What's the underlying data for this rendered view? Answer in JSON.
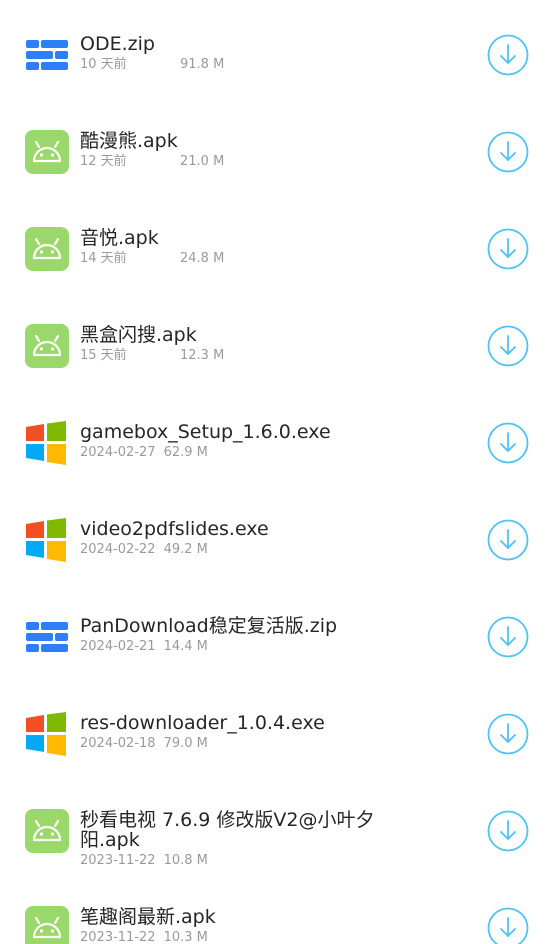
{
  "colors": {
    "accent": "#4fc3f7",
    "android_green": "#9bd86b",
    "zip_blue": "#2d7ff5",
    "win_red": "#f25022",
    "win_green": "#7fba00",
    "win_blue": "#03a9f4",
    "win_yellow": "#ffb900"
  },
  "files": [
    {
      "name": "ODE.zip",
      "date": "10 天前",
      "size": "91.8 M",
      "icon": "zip-file-icon"
    },
    {
      "name": "酷漫熊.apk",
      "date": "12 天前",
      "size": "21.0 M",
      "icon": "android-icon"
    },
    {
      "name": "音悦.apk",
      "date": "14 天前",
      "size": "24.8 M",
      "icon": "android-icon"
    },
    {
      "name": "黑盒闪搜.apk",
      "date": "15 天前",
      "size": "12.3 M",
      "icon": "android-icon"
    },
    {
      "name": "gamebox_Setup_1.6.0.exe",
      "date": "2024-02-27",
      "size": "62.9 M",
      "icon": "windows-icon"
    },
    {
      "name": "video2pdfslides.exe",
      "date": "2024-02-22",
      "size": "49.2 M",
      "icon": "windows-icon"
    },
    {
      "name": "PanDownload稳定复活版.zip",
      "date": "2024-02-21",
      "size": "14.4 M",
      "icon": "zip-file-icon"
    },
    {
      "name": "res-downloader_1.0.4.exe",
      "date": "2024-02-18",
      "size": "79.0 M",
      "icon": "windows-icon"
    },
    {
      "name": "秒看电视 7.6.9 修改版V2@小叶夕阳.apk",
      "date": "2023-11-22",
      "size": "10.8 M",
      "icon": "android-icon"
    },
    {
      "name": "笔趣阁最新.apk",
      "date": "2023-11-22",
      "size": "10.3 M",
      "icon": "android-icon"
    }
  ]
}
